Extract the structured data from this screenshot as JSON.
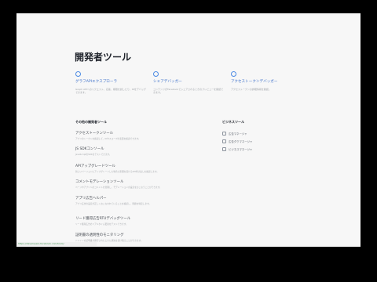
{
  "page": {
    "title": "開発者ツール"
  },
  "features": [
    {
      "icon": "graph-explorer-icon",
      "title": "グラフAPIエクスプローラ",
      "description": "Graph APIへのリクエスト、応答、権限を試したり、IDをデバッグできます。"
    },
    {
      "icon": "share-debugger-icon",
      "title": "シェアデバッガー",
      "description": "コンテンツがFacebookでシェアされるときのプレビューを確認できます。"
    },
    {
      "icon": "access-token-debugger-icon",
      "title": "アクセストークンデバッガー",
      "description": "アクセストークンの詳細情報を確認。"
    }
  ],
  "other_tools": {
    "heading": "その他の開発者ツール",
    "items": [
      {
        "name": "アクセストークンツール",
        "description": "アプリのトークンを確認して、IDやスコープの変更を確認できます。"
      },
      {
        "name": "JS SDKコンソール",
        "description": "JavaScriptのSDKをテストできます。"
      },
      {
        "name": "APIアップグレードツール",
        "description": "新しいバージョンにアップグレードした場合に影響を受けるAPI呼び出しを確認します。"
      },
      {
        "name": "コメントモデレーションツール",
        "description": "ページやアプリへのコメントを管理し、モデレーションの設定をおこなうことができます。"
      },
      {
        "name": "アプリ広告ヘルパー",
        "description": "アプリ広告の設定が正しくおこなわれていることを確認し、問題を特定します。"
      },
      {
        "name": "リード獲得広告RTUデバッグツール",
        "description": "リード獲得広告のリアルタイム更新をテストできます。"
      },
      {
        "name": "証明書の透明性のモニタリング",
        "description": "ドメインの証明書が発行されたときに通知を受け取ることができます。"
      }
    ]
  },
  "business_tools": {
    "heading": "ビジネスツール",
    "items": [
      {
        "icon": "ads-manager-icon",
        "label": "広告マネージャ"
      },
      {
        "icon": "business-settings-icon",
        "label": "広告ダクマネージャ"
      },
      {
        "icon": "business-manager-icon",
        "label": "ビジネスマネージャ"
      }
    ]
  },
  "status_bar": {
    "url": "https://developers.facebook.com/tools/"
  },
  "colors": {
    "background": "#000000",
    "page": "#f7f7f7",
    "link": "#3b6fc9",
    "status_url": "#4a9a5a"
  }
}
